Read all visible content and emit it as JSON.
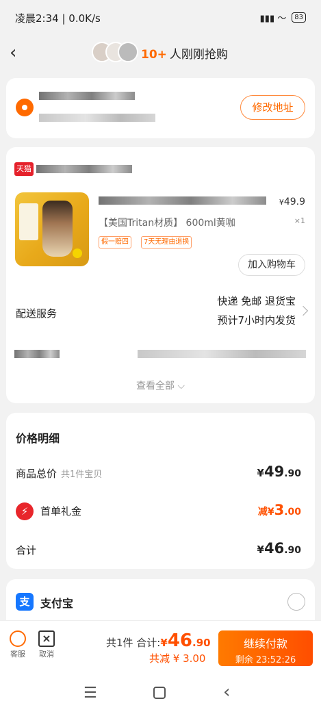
{
  "status_bar": {
    "time": "凌晨2:34 | 0.0K/s",
    "right": "▮▮▮ 〜",
    "battery": "83"
  },
  "nav": {
    "back": "‹",
    "count": "10+",
    "title": "人刚刚抢购"
  },
  "address": {
    "edit_label": "修改地址"
  },
  "shop": {
    "badge": "天猫"
  },
  "product": {
    "price_symbol": "¥",
    "price": "49.9",
    "spec": "【美国Tritan材质】 600ml黄咖",
    "quantity": "×1",
    "tags": [
      "假一赔四",
      "7天无理由退换"
    ],
    "add_cart_label": "加入购物车"
  },
  "delivery": {
    "label": "配送服务",
    "line1": "快递 免邮 退货宝",
    "line2": "预计7小时内发货"
  },
  "see_all": "查看全部 ⌵",
  "price_detail": {
    "title": "价格明细",
    "goods_label": "商品总价",
    "goods_sub": "共1件宝贝",
    "goods_symbol": "¥",
    "goods_int": "49",
    "goods_dec": ".90",
    "gift_label": "首单礼金",
    "gift_prefix": "减",
    "gift_symbol": "¥",
    "gift_int": "3",
    "gift_dec": ".00",
    "sum_label": "合计",
    "sum_symbol": "¥",
    "sum_int": "46",
    "sum_dec": ".90"
  },
  "payment": {
    "alipay_label": "支付宝",
    "alipay_icon": "支"
  },
  "bottom": {
    "service_label": "客服",
    "cancel_label": "取消",
    "total_prefix": "共1件 合计:",
    "total_symbol": "¥",
    "total_int": "46",
    "total_dec": ".90",
    "saved": "共减 ¥ 3.00",
    "pay_label": "继续付款",
    "countdown": "剩余 23:52:26"
  },
  "colors": {
    "accent": "#ff5000",
    "tmall": "#e5212b",
    "alipay": "#1677ff"
  }
}
